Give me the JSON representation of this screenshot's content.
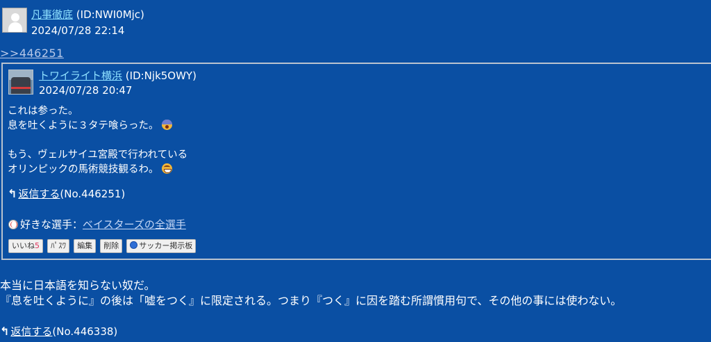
{
  "post": {
    "user_name": "凡事徹底",
    "user_id": "(ID:NWI0Mjc)",
    "date": "2024/07/28 22:14",
    "anchor": ">>446251",
    "body_lines": [
      "本当に日本語を知らない奴だ。",
      "『息を吐くように』の後は「嘘をつく』に限定される。つまり『つく』に因を踏む所謂慣用句で、その他の事には使わない。"
    ],
    "reply_label": "返信する",
    "reply_no": "(No.446338)"
  },
  "quoted": {
    "user_name": "トワイライト横浜",
    "user_id": "(ID:Njk5OWY)",
    "date": "2024/07/28 20:47",
    "body_lines": [
      "これは参った。",
      "息を吐くように３タテ喰らった。",
      "",
      "もう、ヴェルサイユ宮殿で行われている",
      "オリンピックの馬術競技観るわ。"
    ],
    "reply_label": "返信する",
    "reply_no": "(No.446251)",
    "favorite_prefix": "好きな選手：",
    "favorite_link": "ベイスターズの全選手",
    "buttons": {
      "like": "いいね",
      "like_count": "5",
      "pass": "ﾊﾟｽﾜ",
      "edit": "編集",
      "delete": "削除",
      "board": "サッカー掲示板"
    }
  }
}
